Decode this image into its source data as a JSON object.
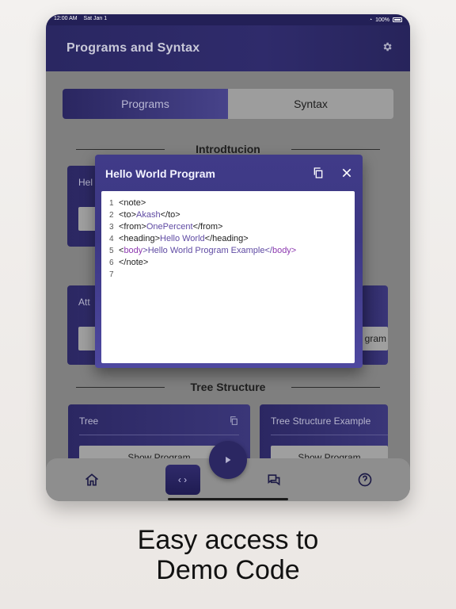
{
  "status": {
    "time": "12:00 AM",
    "date": "Sat Jan 1",
    "battery": "100%"
  },
  "header": {
    "title": "Programs and Syntax"
  },
  "tabs": {
    "programs": "Programs",
    "syntax": "Syntax"
  },
  "sections": {
    "intro": "Introdtucion",
    "tree": "Tree Structure"
  },
  "cards": {
    "hello_partial": "Hel",
    "attr_partial": "Att",
    "right_btn_partial": "gram",
    "tree": {
      "title": "Tree",
      "button": "Show Program"
    },
    "tree_example": {
      "title": "Tree Structure Example",
      "button": "Show Program"
    }
  },
  "modal": {
    "title": "Hello World Program",
    "lines": [
      {
        "n": "1",
        "a": "<note>",
        "b": "",
        "c": "",
        "d": ""
      },
      {
        "n": "2",
        "a": "<to>",
        "b": "Akash",
        "c": "</to>",
        "d": ""
      },
      {
        "n": "3",
        "a": "<from>",
        "b": "OnePercent",
        "c": "</from>",
        "d": ""
      },
      {
        "n": "4",
        "a": "<heading>",
        "b": "Hello World",
        "c": "</heading>",
        "d": ""
      },
      {
        "n": "5",
        "a": "<",
        "b": "body",
        "c": ">Hello World Program Example</",
        "d": "body>"
      },
      {
        "n": "6",
        "a": "</note>",
        "b": "",
        "c": "",
        "d": ""
      },
      {
        "n": "7",
        "a": "",
        "b": "",
        "c": "",
        "d": ""
      }
    ]
  },
  "caption": {
    "line1": "Easy access to",
    "line2": "Demo Code"
  }
}
